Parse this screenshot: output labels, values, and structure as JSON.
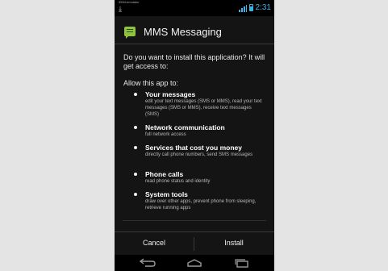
{
  "status_bar": {
    "window_title": "5554:emulator",
    "time": "2:31",
    "download_icon": "download-icon",
    "signal_icon": "signal-icon",
    "battery_icon": "battery-icon"
  },
  "dialog": {
    "app_name": "MMS Messaging",
    "app_icon": "message-bubble-icon",
    "question": "Do you want to install this application? It will get access to:",
    "allow_label": "Allow this app to:",
    "permissions": [
      {
        "title": "Your messages",
        "desc": "edit your text messages (SMS or MMS), read your text messages (SMS or MMS), receive text messages (SMS)"
      },
      {
        "title": "Network communication",
        "desc": "full network access"
      },
      {
        "title": "Services that cost you money",
        "desc": "directly call phone numbers, send SMS messages"
      },
      {
        "title": "Phone calls",
        "desc": "read phone status and identity"
      },
      {
        "title": "System tools",
        "desc": "draw over other apps, prevent phone from sleeping, retrieve running apps"
      }
    ],
    "buttons": {
      "cancel": "Cancel",
      "install": "Install"
    }
  },
  "nav_bar": {
    "back_icon": "back-icon",
    "home_icon": "home-icon",
    "recents_icon": "recents-icon"
  },
  "colors": {
    "accent": "#3fb0e8",
    "app_icon": "#8fc33f",
    "dialog_bg": "#141414"
  }
}
